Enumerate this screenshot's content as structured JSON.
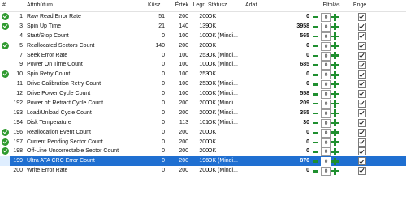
{
  "columns": {
    "id": "#",
    "attribute": "Attribútum",
    "threshold": "Küsz...",
    "value": "Érték",
    "worst": "Legr...",
    "status": "Státusz",
    "data": "Adat",
    "offset": "Eltolás",
    "enable": "Enge..."
  },
  "rows": [
    {
      "id": "1",
      "name": "Raw Read Error Rate",
      "threshold": "51",
      "value": "200",
      "worst": "200",
      "status": "OK",
      "data": "0",
      "offset": "0",
      "enabled": true,
      "ok_icon": true
    },
    {
      "id": "3",
      "name": "Spin Up Time",
      "threshold": "21",
      "value": "140",
      "worst": "139",
      "status": "OK",
      "data": "3958",
      "offset": "0",
      "enabled": true,
      "ok_icon": true
    },
    {
      "id": "4",
      "name": "Start/Stop Count",
      "threshold": "0",
      "value": "100",
      "worst": "100",
      "status": "OK (Mindi...",
      "data": "565",
      "offset": "0",
      "enabled": true,
      "ok_icon": false
    },
    {
      "id": "5",
      "name": "Reallocated Sectors Count",
      "threshold": "140",
      "value": "200",
      "worst": "200",
      "status": "OK",
      "data": "0",
      "offset": "0",
      "enabled": true,
      "ok_icon": true
    },
    {
      "id": "7",
      "name": "Seek Error Rate",
      "threshold": "0",
      "value": "100",
      "worst": "253",
      "status": "OK (Mindi...",
      "data": "0",
      "offset": "0",
      "enabled": true,
      "ok_icon": false
    },
    {
      "id": "9",
      "name": "Power On Time Count",
      "threshold": "0",
      "value": "100",
      "worst": "100",
      "status": "OK (Mindi...",
      "data": "685",
      "offset": "0",
      "enabled": true,
      "ok_icon": false
    },
    {
      "id": "10",
      "name": "Spin Retry Count",
      "threshold": "0",
      "value": "100",
      "worst": "253",
      "status": "OK",
      "data": "0",
      "offset": "0",
      "enabled": true,
      "ok_icon": true
    },
    {
      "id": "11",
      "name": "Drive Calibration Retry Count",
      "threshold": "0",
      "value": "100",
      "worst": "253",
      "status": "OK (Mindi...",
      "data": "0",
      "offset": "0",
      "enabled": true,
      "ok_icon": false
    },
    {
      "id": "12",
      "name": "Drive Power Cycle Count",
      "threshold": "0",
      "value": "100",
      "worst": "100",
      "status": "OK (Mindi...",
      "data": "558",
      "offset": "0",
      "enabled": true,
      "ok_icon": false
    },
    {
      "id": "192",
      "name": "Power off Retract Cycle Count",
      "threshold": "0",
      "value": "200",
      "worst": "200",
      "status": "OK (Mindi...",
      "data": "209",
      "offset": "0",
      "enabled": true,
      "ok_icon": false
    },
    {
      "id": "193",
      "name": "Load/Unload Cycle Count",
      "threshold": "0",
      "value": "200",
      "worst": "200",
      "status": "OK (Mindi...",
      "data": "355",
      "offset": "0",
      "enabled": true,
      "ok_icon": false
    },
    {
      "id": "194",
      "name": "Disk Temperature",
      "threshold": "0",
      "value": "113",
      "worst": "101",
      "status": "OK (Mindi...",
      "data": "30",
      "offset": "0",
      "enabled": true,
      "ok_icon": false
    },
    {
      "id": "196",
      "name": "Reallocation Event Count",
      "threshold": "0",
      "value": "200",
      "worst": "200",
      "status": "OK",
      "data": "0",
      "offset": "0",
      "enabled": true,
      "ok_icon": true
    },
    {
      "id": "197",
      "name": "Current Pending Sector Count",
      "threshold": "0",
      "value": "200",
      "worst": "200",
      "status": "OK",
      "data": "0",
      "offset": "0",
      "enabled": true,
      "ok_icon": true
    },
    {
      "id": "198",
      "name": "Off-Line Uncorrectable Sector Count",
      "threshold": "0",
      "value": "200",
      "worst": "200",
      "status": "OK",
      "data": "0",
      "offset": "0",
      "enabled": true,
      "ok_icon": true
    },
    {
      "id": "199",
      "name": "Ultra ATA CRC Error Count",
      "threshold": "0",
      "value": "200",
      "worst": "196",
      "status": "OK (Mindi...",
      "data": "876",
      "offset": "0",
      "enabled": true,
      "ok_icon": false,
      "selected": true
    },
    {
      "id": "200",
      "name": "Write Error Rate",
      "threshold": "0",
      "value": "200",
      "worst": "200",
      "status": "OK (Mindi...",
      "data": "0",
      "offset": "0",
      "enabled": true,
      "ok_icon": false
    }
  ]
}
